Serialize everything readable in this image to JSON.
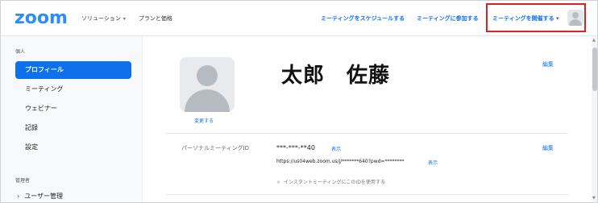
{
  "header": {
    "logo": "zoom",
    "nav_left": [
      {
        "label": "ソリューション",
        "caret": "▾"
      },
      {
        "label": "プランと価格"
      }
    ],
    "schedule_label": "ミーティングをスケジュールする",
    "join_label": "ミーティングに参加する",
    "host_label": "ミーティングを開催する",
    "host_caret": "▾"
  },
  "sidebar": {
    "personal_section": "個人",
    "items": [
      {
        "label": "プロフィール",
        "active": true
      },
      {
        "label": "ミーティング"
      },
      {
        "label": "ウェビナー"
      },
      {
        "label": "記録"
      },
      {
        "label": "設定"
      }
    ],
    "admin_section": "管理者",
    "admin_items": [
      {
        "label": "ユーザー管理",
        "chevron": "›"
      }
    ]
  },
  "profile": {
    "change_label": "変更する",
    "name": "太郎　佐藤",
    "edit_label": "編集"
  },
  "pmi": {
    "label": "パーソナルミーティングID",
    "value": "***-***-**40",
    "show_label": "表示",
    "url": "https://us04web.zoom.us/j/*******640?pwd=********",
    "url_show_label": "表示",
    "use_for_instant": "インスタントミーティングにこのIDを使用する",
    "use_icon": "×",
    "edit_label": "編集"
  },
  "colors": {
    "brand": "#2d8cff",
    "link": "#0e71eb",
    "active_bg": "#0e71eb",
    "highlight_box": "#e02020"
  }
}
